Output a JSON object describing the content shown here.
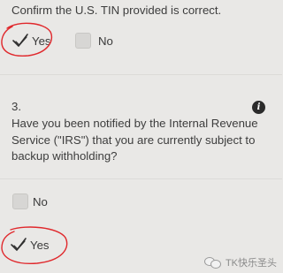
{
  "question1": {
    "text": "Confirm the U.S. TIN provided is correct.",
    "options": [
      {
        "label": "Yes",
        "checked": true
      },
      {
        "label": "No",
        "checked": false
      }
    ]
  },
  "question3": {
    "number": "3.",
    "text": "Have you been notified by the Internal Revenue Service (\"IRS\") that you are currently subject to backup withholding?",
    "info_icon": "info-icon",
    "options": [
      {
        "label": "No",
        "checked": false
      },
      {
        "label": "Yes",
        "checked": true
      }
    ]
  },
  "annotation": {
    "color": "#e0282c"
  },
  "watermark": {
    "text": "TK快乐圣头",
    "icon": "wechat-icon"
  },
  "colors": {
    "background": "#e9e8e6",
    "checkbox": "#d7d6d4",
    "text": "#3d3d3d"
  }
}
